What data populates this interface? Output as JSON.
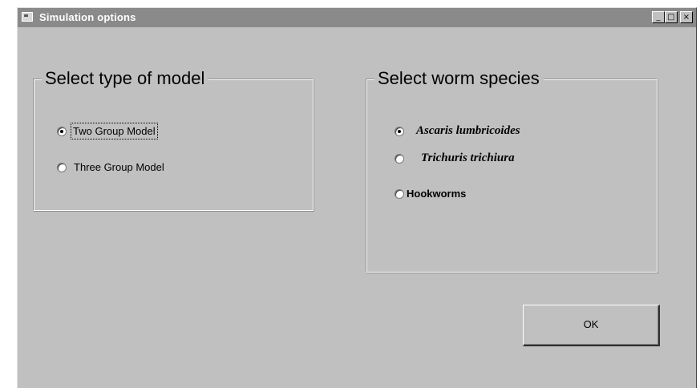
{
  "window": {
    "title": "Simulation options",
    "controls": {
      "minimize_glyph": "_",
      "maximize_glyph": "□",
      "close_glyph": "×"
    }
  },
  "model_group": {
    "legend": "Select type of model",
    "selected": "Two Group Model",
    "options": [
      {
        "label": "Two Group Model",
        "checked": true
      },
      {
        "label": "Three Group Model",
        "checked": false
      }
    ]
  },
  "species_group": {
    "legend": "Select worm species",
    "selected": "Ascaris lumbricoides",
    "options": [
      {
        "label": "Ascaris lumbricoides",
        "checked": true
      },
      {
        "label": "Trichuris trichiura",
        "checked": false
      },
      {
        "label": "Hookworms",
        "checked": false
      }
    ]
  },
  "actions": {
    "ok_label": "OK"
  }
}
